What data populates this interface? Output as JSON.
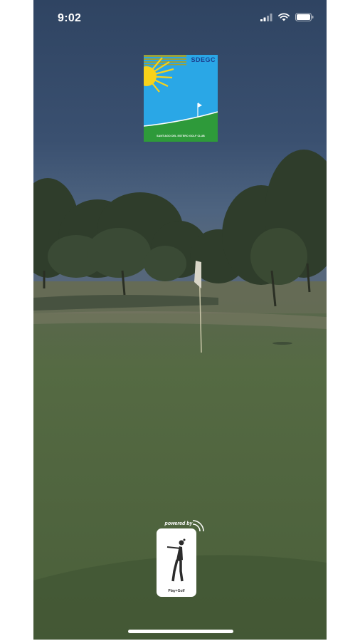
{
  "status_bar": {
    "time": "9:02",
    "icons": [
      "signal-icon",
      "wifi-icon",
      "battery-icon"
    ]
  },
  "splash": {
    "logo": {
      "brand_text": "SDEGC",
      "caption": "SANTIAGO DEL ESTERO GOLF CLUB",
      "colors": {
        "sky": "#2aa7e6",
        "grass": "#2e9a3a",
        "sun": "#f7d21a",
        "stripe": "#9aa13a"
      }
    },
    "background": "golf-course-photo",
    "powered_by": {
      "label": "powered by",
      "brand": "Play+Golf",
      "icon": "golfer-icon"
    }
  },
  "colors": {
    "overlay": "#2f4462",
    "fairway": "#4a5a3c"
  }
}
